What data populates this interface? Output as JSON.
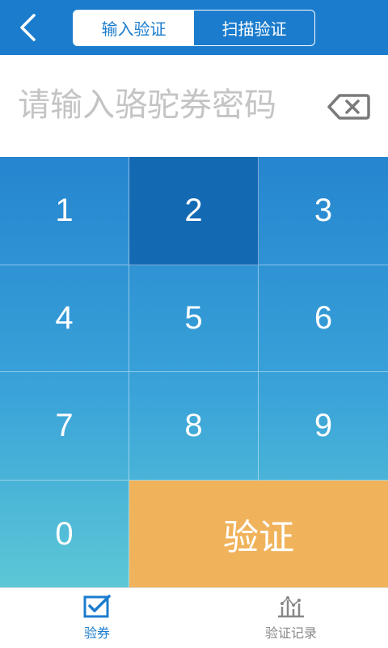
{
  "header": {
    "back_icon": "chevron-left-icon",
    "tabs": [
      {
        "label": "输入验证",
        "active": true
      },
      {
        "label": "扫描验证",
        "active": false
      }
    ],
    "background_color": "#1b7ccd"
  },
  "input": {
    "placeholder": "请输入骆驼券密码",
    "value": "",
    "backspace_icon": "backspace-icon"
  },
  "keypad": {
    "keys": [
      "1",
      "2",
      "3",
      "4",
      "5",
      "6",
      "7",
      "8",
      "9",
      "0"
    ],
    "pressed_key": "2",
    "verify_label": "验证",
    "verify_color": "#f0b35c"
  },
  "nav": {
    "items": [
      {
        "label": "验券",
        "icon": "checkbox-icon",
        "active": true
      },
      {
        "label": "验证记录",
        "icon": "chart-icon",
        "active": false
      }
    ]
  }
}
